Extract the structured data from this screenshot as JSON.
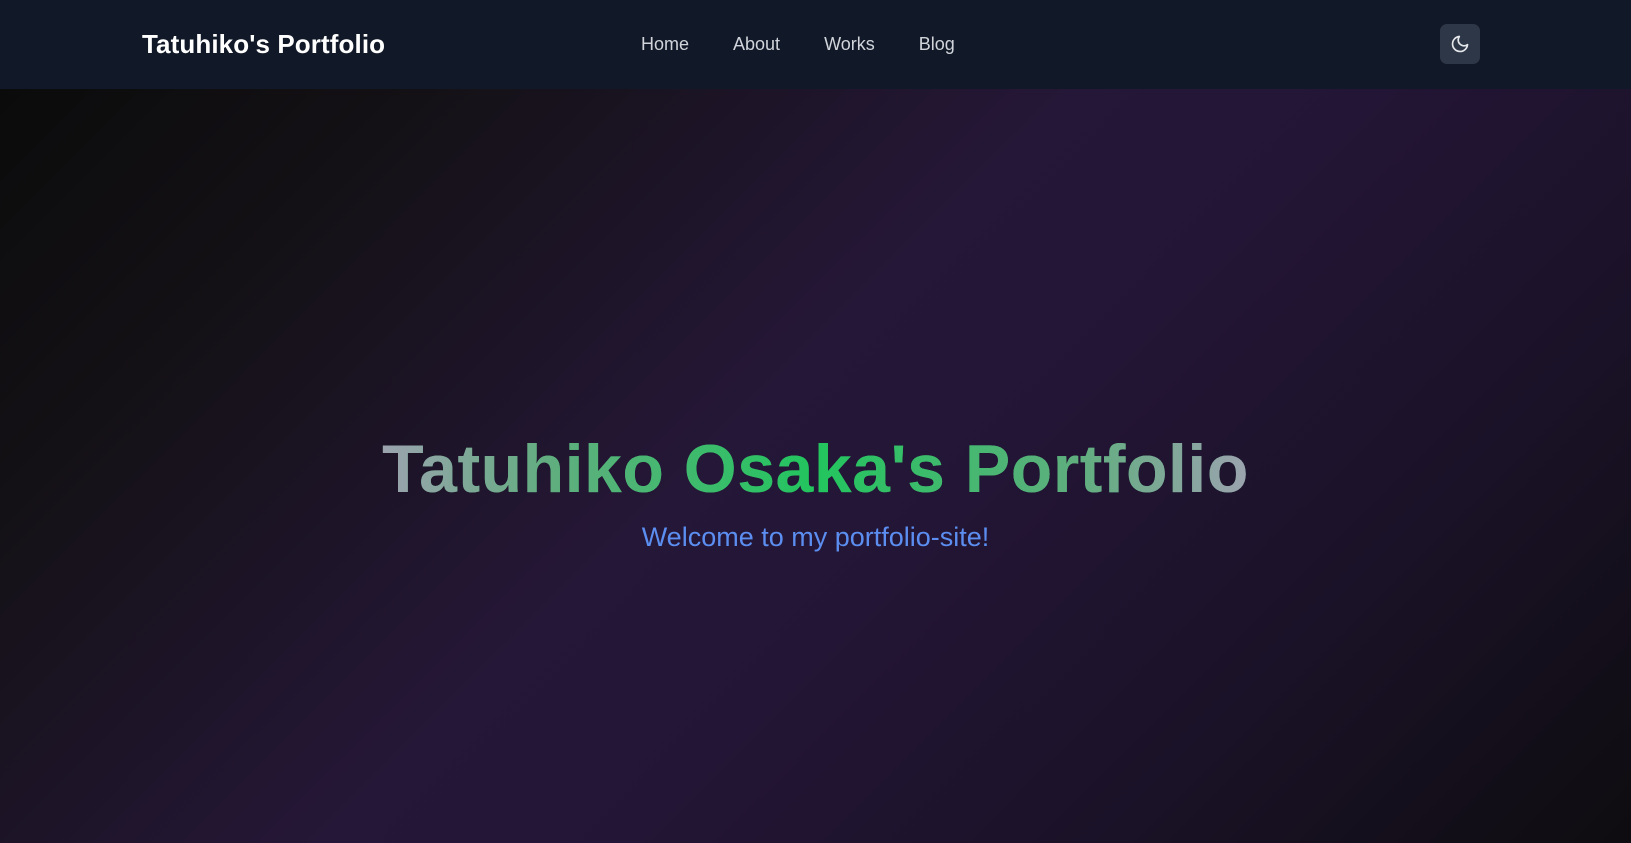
{
  "header": {
    "brand": "Tatuhiko's Portfolio",
    "nav": [
      {
        "label": "Home"
      },
      {
        "label": "About"
      },
      {
        "label": "Works"
      },
      {
        "label": "Blog"
      }
    ],
    "theme_toggle_icon": "moon-icon"
  },
  "hero": {
    "title": "Tatuhiko Osaka's Portfolio",
    "subtitle": "Welcome to my portfolio-site!"
  },
  "colors": {
    "navbar_bg": "#111827",
    "title_gradient_center": "#22c55e",
    "title_gradient_edges": "#9ca3af",
    "subtitle": "#5b8ef0",
    "hero_accent": "#251737"
  }
}
